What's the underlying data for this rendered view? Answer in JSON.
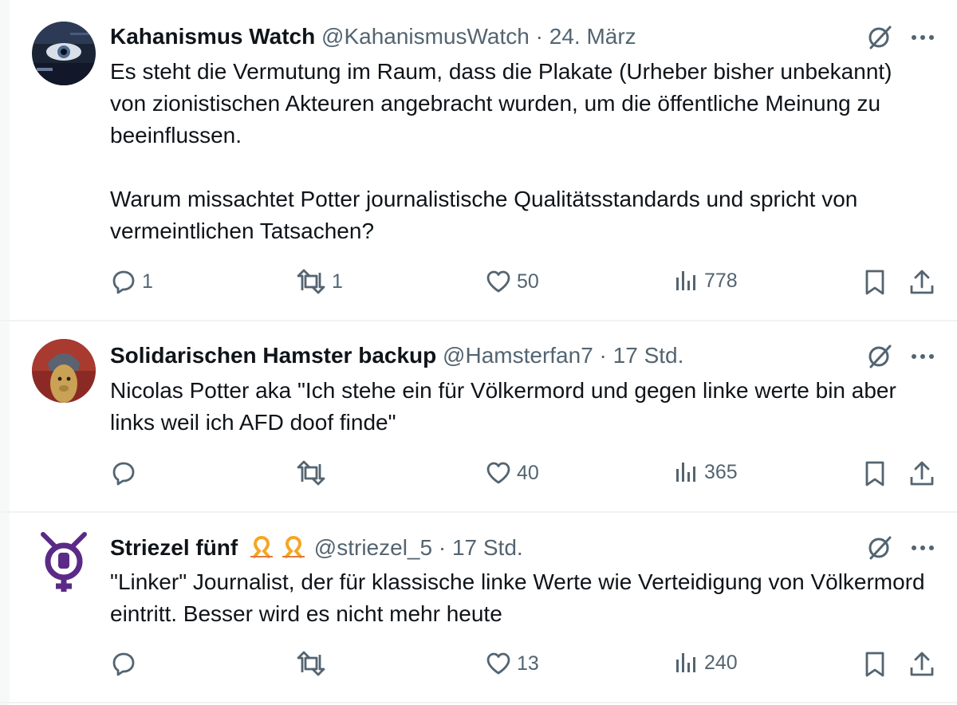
{
  "tweets": [
    {
      "name": "Kahanismus Watch",
      "handle": "@KahanismusWatch",
      "dot": "·",
      "time": "24. März",
      "text": "Es steht die Vermutung im Raum, dass die Plakate (Urheber bisher unbekannt) von zionistischen Akteuren angebracht wurden, um die öffentliche Meinung zu beeinflussen.\n\nWarum missachtet Potter journalistische Qualitätsstandards und spricht von vermeintlichen Tatsachen?",
      "replies": "1",
      "reposts": "1",
      "likes": "50",
      "views": "778"
    },
    {
      "name": "Solidarischen Hamster backup",
      "handle": "@Hamsterfan7",
      "dot": "·",
      "time": "17 Std.",
      "text": "Nicolas Potter aka \"Ich stehe ein für Völkermord und gegen linke werte bin aber links weil ich AFD doof finde\"",
      "replies": "",
      "reposts": "",
      "likes": "40",
      "views": "365"
    },
    {
      "name": "Striezel fünf",
      "handle": "@striezel_5",
      "dot": "·",
      "time": "17 Std.",
      "text": "\"Linker\" Journalist, der für klassische linke Werte wie Verteidigung von Völkermord eintritt. Besser wird es nicht mehr heute",
      "replies": "",
      "reposts": "",
      "likes": "13",
      "views": "240"
    }
  ],
  "icons": {
    "grok": "grok-icon",
    "more": "more-icon",
    "reply": "reply-icon",
    "repost": "repost-icon",
    "like": "like-icon",
    "views": "views-icon",
    "bookmark": "bookmark-icon",
    "share": "share-icon"
  },
  "colors": {
    "text": "#0f1419",
    "muted": "#536471",
    "divider": "#eff3f4",
    "ribbon": "#f5a623",
    "symbol_purple": "#5b2a86"
  }
}
